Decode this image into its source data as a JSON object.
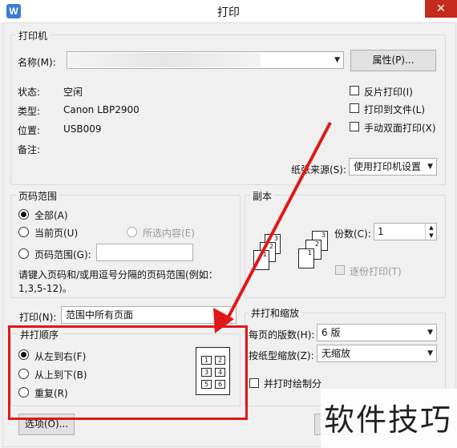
{
  "window": {
    "title": "打印",
    "close": "✕"
  },
  "printer": {
    "legend": "打印机",
    "name_label": "名称(M):",
    "name_value": "",
    "properties_button": "属性(P)...",
    "status_label": "状态:",
    "status_value": "空闲",
    "type_label": "类型:",
    "type_value": "Canon LBP2900",
    "where_label": "位置:",
    "where_value": "USB009",
    "comment_label": "备注:",
    "reverse_print": "反片打印(I)",
    "print_to_file": "打印到文件(L)",
    "manual_duplex": "手动双面打印(X)",
    "paper_source_label": "纸张来源(S):",
    "paper_source_value": "使用打印机设置"
  },
  "page_range": {
    "legend": "页码范围",
    "all": "全部(A)",
    "current": "当前页(U)",
    "selection": "所选内容(E)",
    "pages": "页码范围(G):",
    "hint": "请键入页码和/或用逗号分隔的页码范围(例如：1,3,5-12)。",
    "hint_line1": "请键入页码和/或用逗号分隔的页码范围(例如：",
    "hint_line2": "1,3,5-12)。"
  },
  "copies": {
    "legend": "副本",
    "count_label": "份数(C):",
    "count_value": "1",
    "collate": "逐份打印(T)"
  },
  "print_what": {
    "label": "打印(N):",
    "value": "范围中所有页面"
  },
  "order": {
    "legend": "并打顺序",
    "left_to_right": "从左到右(F)",
    "top_to_bottom": "从上到下(B)",
    "repeat": "重复(R)",
    "preview_cells": [
      "1",
      "2",
      "3",
      "4",
      "5",
      "6"
    ]
  },
  "zoom": {
    "legend": "并打和缩放",
    "pages_per_sheet_label": "每页的版数(H):",
    "pages_per_sheet_value": "6 版",
    "scale_label": "按纸型缩放(Z):",
    "scale_value": "无缩放",
    "draw_border": "并打时绘制分"
  },
  "options_button": "选项(O)...",
  "watermark": "软件技巧",
  "colors": {
    "highlight": "#e01818",
    "close": "#c42b1c"
  }
}
